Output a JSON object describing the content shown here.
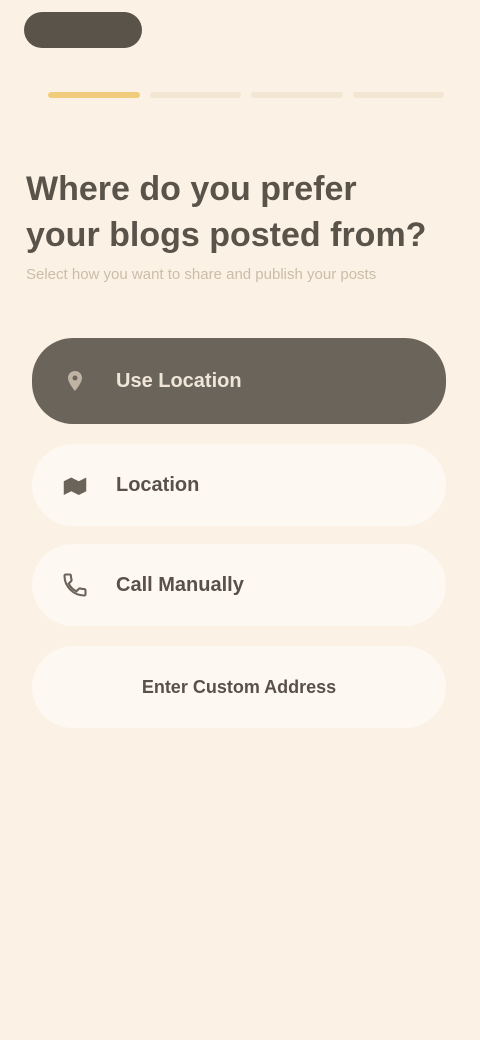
{
  "screen": {
    "title": "Where do you prefer your blogs posted from?",
    "subtitle": "Select how you want to share and publish your posts"
  },
  "progress": {
    "total": 4,
    "active": 1
  },
  "options": [
    {
      "label": "Use Location",
      "icon": "location-icon",
      "selected": true
    },
    {
      "label": "Location",
      "icon": "map-icon",
      "selected": false
    },
    {
      "label": "Call Manually",
      "icon": "phone-icon",
      "selected": false
    },
    {
      "label": "Enter Custom Address",
      "icon": "",
      "selected": false
    }
  ],
  "colors": {
    "background": "#fbf1e4",
    "selected_option": "#6b645b",
    "option": "#fdf8f1",
    "progress_active": "#f1cc7d",
    "progress_inactive": "#f3e6d3",
    "text_primary": "#5a534a",
    "text_secondary": "#cbbda9"
  }
}
